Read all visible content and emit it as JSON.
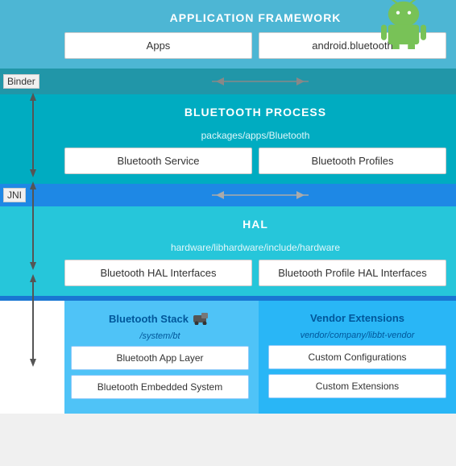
{
  "android_logo": {
    "alt": "Android Logo"
  },
  "app_framework": {
    "title": "APPLICATION FRAMEWORK",
    "boxes": [
      {
        "id": "apps-box",
        "label": "Apps"
      },
      {
        "id": "android-bluetooth-box",
        "label": "android.bluetooth"
      }
    ]
  },
  "binder_label": "Binder",
  "bluetooth_process": {
    "title": "BLUETOOTH PROCESS",
    "sub_label": "packages/apps/Bluetooth",
    "boxes": [
      {
        "id": "bluetooth-service-box",
        "label": "Bluetooth Service"
      },
      {
        "id": "bluetooth-profiles-box",
        "label": "Bluetooth Profiles"
      }
    ]
  },
  "jni_label": "JNI",
  "hal": {
    "title": "HAL",
    "sub_label": "hardware/libhardware/include/hardware",
    "boxes": [
      {
        "id": "bluetooth-hal-interfaces-box",
        "label": "Bluetooth HAL Interfaces"
      },
      {
        "id": "bluetooth-profile-hal-box",
        "label": "Bluetooth Profile HAL Interfaces"
      }
    ]
  },
  "bluetooth_stack": {
    "title": "Bluetooth Stack",
    "sub_label": "/system/bt",
    "boxes": [
      {
        "id": "bluetooth-app-layer-box",
        "label": "Bluetooth App Layer"
      },
      {
        "id": "bluetooth-embedded-box",
        "label": "Bluetooth Embedded System"
      }
    ]
  },
  "vendor_extensions": {
    "title": "Vendor Extensions",
    "sub_label": "vendor/company/libbt-vendor",
    "boxes": [
      {
        "id": "custom-configurations-box",
        "label": "Custom Configurations"
      },
      {
        "id": "custom-extensions-box",
        "label": "Custom Extensions"
      }
    ]
  }
}
